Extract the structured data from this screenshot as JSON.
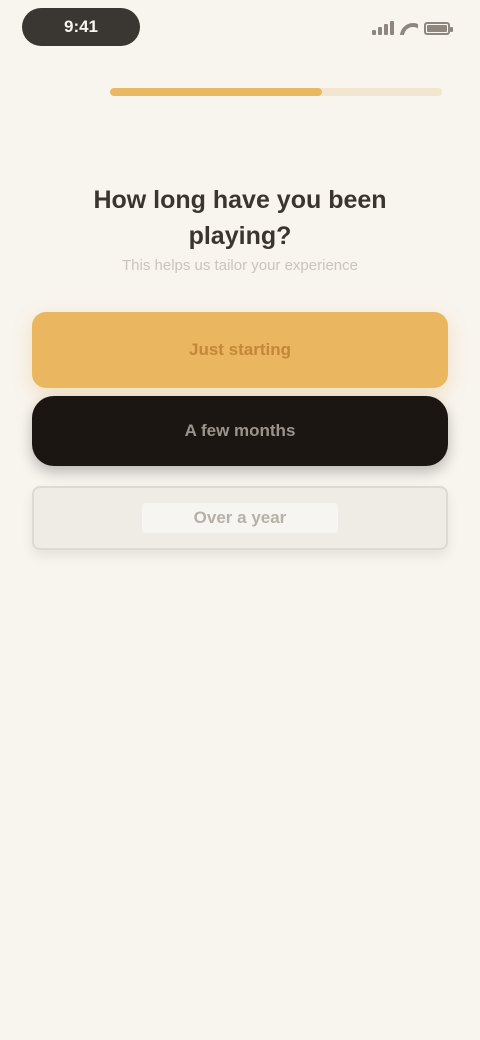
{
  "status_bar": {
    "time": "9:41",
    "icons": [
      "signal-icon",
      "wifi-icon",
      "battery-icon"
    ]
  },
  "progress": {
    "value": 0.64,
    "color": "#e9b863"
  },
  "content": {
    "title": "How long have you been playing?",
    "subtitle": "This helps us tailor your experience"
  },
  "options": {
    "primary_label": "Just starting",
    "dark_label": "A few months",
    "light_label": "Over a year"
  },
  "colors": {
    "background": "#f8f4ee",
    "accent": "#ebb660",
    "dark": "#1c1612"
  }
}
